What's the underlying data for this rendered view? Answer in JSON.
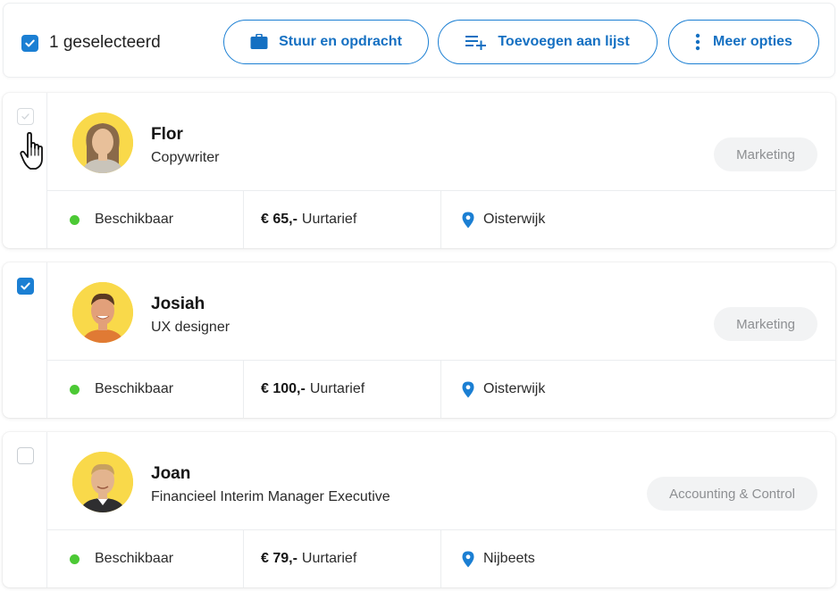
{
  "toolbar": {
    "selected_label": "1 geselecteerd",
    "assign_label": "Stuur en opdracht",
    "add_to_list_label": "Toevoegen aan lijst",
    "more_options_label": "Meer opties"
  },
  "candidates": [
    {
      "name": "Flor",
      "role": "Copywriter",
      "tag": "Marketing",
      "availability": "Beschikbaar",
      "rate_amount": "€ 65,-",
      "rate_unit": "Uurtarief",
      "location": "Oisterwijk",
      "checked": false
    },
    {
      "name": "Josiah",
      "role": "UX designer",
      "tag": "Marketing",
      "availability": "Beschikbaar",
      "rate_amount": "€ 100,-",
      "rate_unit": "Uurtarief",
      "location": "Oisterwijk",
      "checked": true
    },
    {
      "name": "Joan",
      "role": "Financieel Interim Manager Executive",
      "tag": "Accounting & Control",
      "availability": "Beschikbaar",
      "rate_amount": "€ 79,-",
      "rate_unit": "Uurtarief",
      "location": "Nijbeets",
      "checked": false
    }
  ],
  "colors": {
    "accent": "#1b7fd3",
    "available": "#4cc935",
    "avatar_bg": "#f9d94a",
    "tag_bg": "#f2f3f4"
  },
  "icons": [
    "checkbox-checked-icon",
    "briefcase-icon",
    "playlist-add-icon",
    "more-vertical-icon",
    "location-pin-icon",
    "hand-pointer-icon"
  ]
}
